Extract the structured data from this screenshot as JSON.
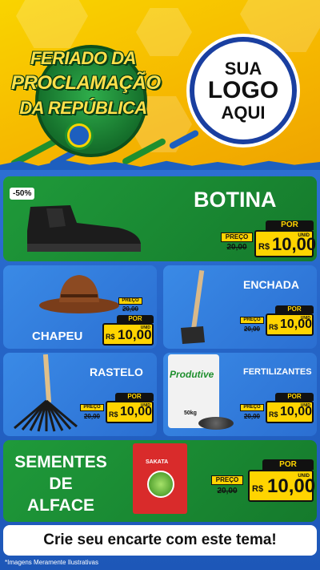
{
  "header": {
    "title_lines": [
      "FERIADO DA",
      "PROCLAMAÇÃO",
      "DA REPÚBLICA"
    ],
    "logo_lines": [
      "SUA",
      "LOGO",
      "AQUI"
    ],
    "colors": {
      "yellow": "#f6c400",
      "green": "#157a2c",
      "blue": "#1d5fbf"
    }
  },
  "products": [
    {
      "name": "BOTINA",
      "discount": "-50%",
      "preco_label": "PREÇO",
      "old_price": "20,00",
      "por_label": "POR",
      "currency": "R$",
      "price": "10,00",
      "unit": "UNID",
      "icon": "boot-icon"
    },
    {
      "name": "CHAPEU",
      "preco_label": "PREÇO",
      "old_price": "20,00",
      "por_label": "POR",
      "currency": "R$",
      "price": "10,00",
      "unit": "UNID",
      "icon": "hat-icon"
    },
    {
      "name": "ENCHADA",
      "preco_label": "PREÇO",
      "old_price": "20,00",
      "por_label": "POR",
      "currency": "R$",
      "price": "10,00",
      "unit": "UNID",
      "icon": "hoe-icon"
    },
    {
      "name": "RASTELO",
      "preco_label": "PREÇO",
      "old_price": "20,00",
      "por_label": "POR",
      "currency": "R$",
      "price": "10,00",
      "unit": "UNID",
      "icon": "rake-icon"
    },
    {
      "name": "FERTILIZANTES",
      "preco_label": "PREÇO",
      "old_price": "20,00",
      "por_label": "POR",
      "currency": "R$",
      "price": "10,00",
      "unit": "UNID",
      "icon": "fertilizer-bag-icon",
      "bag_brand": "Produtive",
      "bag_weight": "50kg"
    },
    {
      "name_lines": [
        "SEMENTES",
        "DE",
        "ALFACE"
      ],
      "preco_label": "PREÇO",
      "old_price": "20,00",
      "por_label": "POR",
      "currency": "R$",
      "price": "10,00",
      "unit": "UNID",
      "icon": "seed-packet-icon",
      "packet_brand": "SAKATA"
    }
  ],
  "footer": {
    "cta": "Crie seu encarte com este tema!",
    "note": "*Imagens Meramente Ilustrativas"
  }
}
